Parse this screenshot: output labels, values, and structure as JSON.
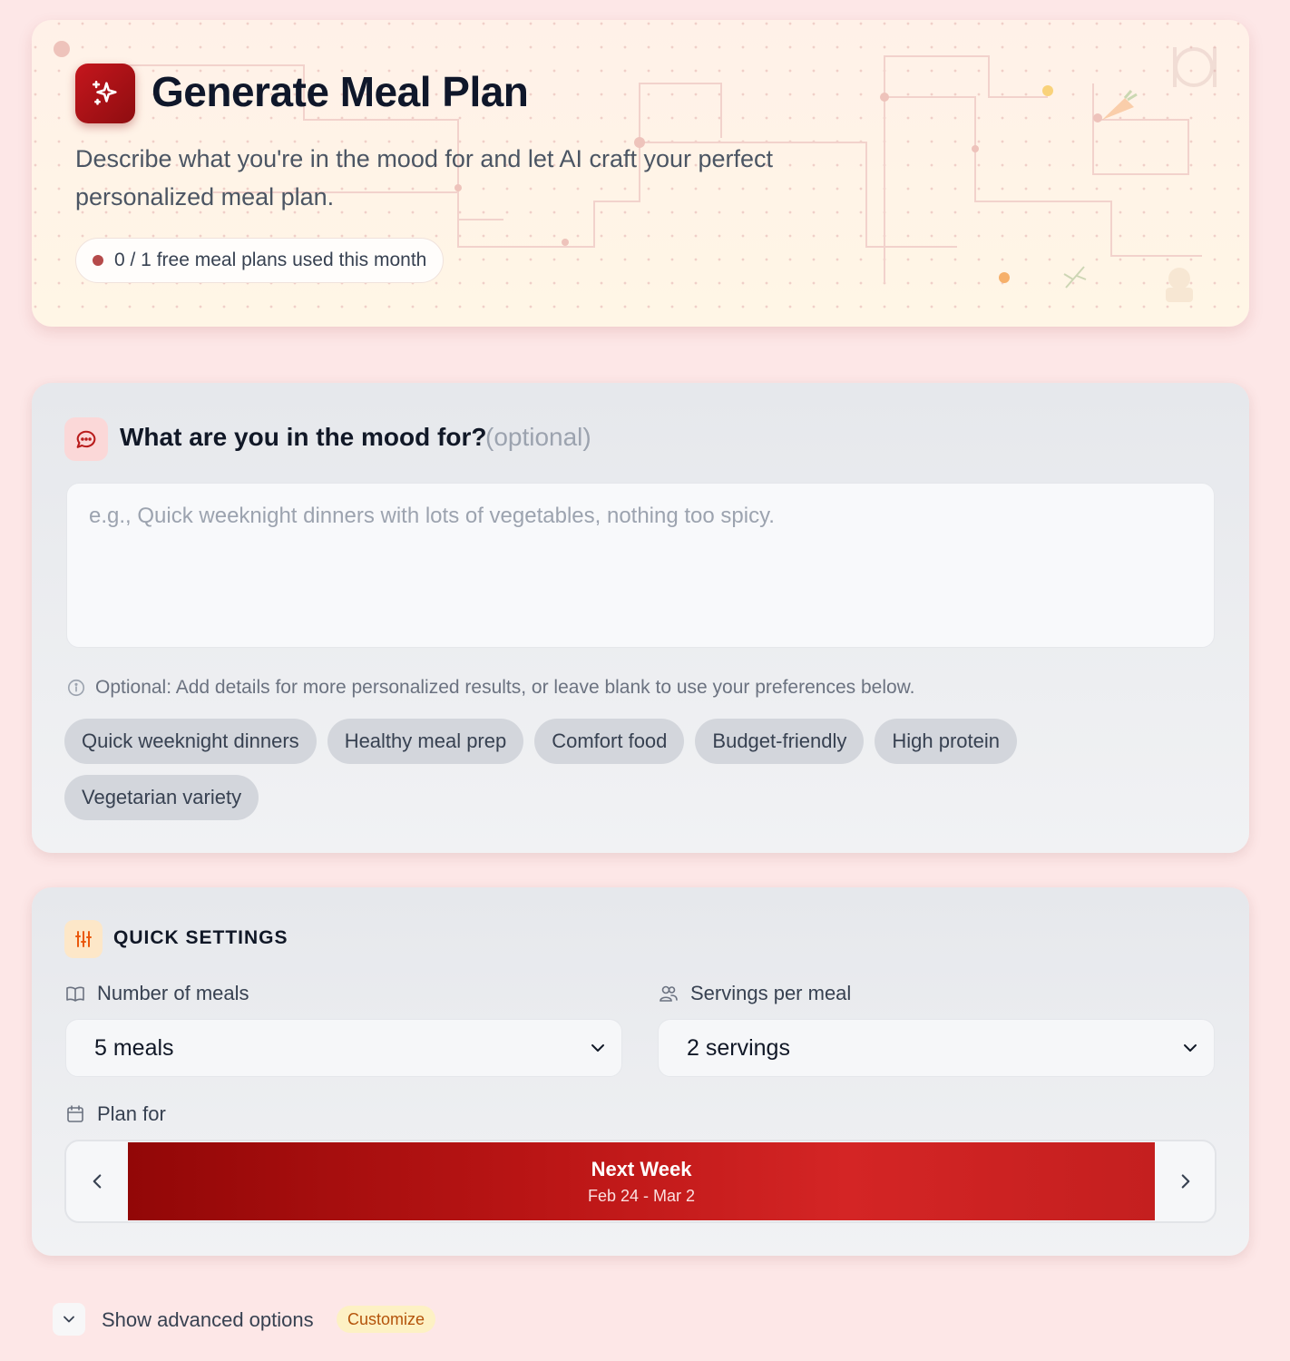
{
  "header": {
    "title": "Generate Meal Plan",
    "description": "Describe what you're in the mood for and let AI craft your perfect personalized meal plan.",
    "usage": "0 / 1 free meal plans used this month",
    "logo_icon": "sparkles-icon"
  },
  "mood": {
    "title": "What are you in the mood for?",
    "optional_label": "(optional)",
    "placeholder": "e.g., Quick weeknight dinners with lots of vegetables, nothing too spicy.",
    "value": "",
    "hint": "Optional: Add details for more personalized results, or leave blank to use your preferences below.",
    "suggestions": [
      "Quick weeknight dinners",
      "Healthy meal prep",
      "Comfort food",
      "Budget-friendly",
      "High protein",
      "Vegetarian variety"
    ]
  },
  "settings": {
    "title": "QUICK SETTINGS",
    "meals_label": "Number of meals",
    "meals_value": "5 meals",
    "servings_label": "Servings per meal",
    "servings_value": "2 servings",
    "plan_for_label": "Plan for",
    "week_title": "Next Week",
    "week_dates": "Feb 24 - Mar 2"
  },
  "advanced": {
    "label": "Show advanced options",
    "badge": "Customize"
  },
  "colors": {
    "brand": "#b31217",
    "page_bg": "#fde7e7",
    "badge_text": "#b4530a"
  }
}
